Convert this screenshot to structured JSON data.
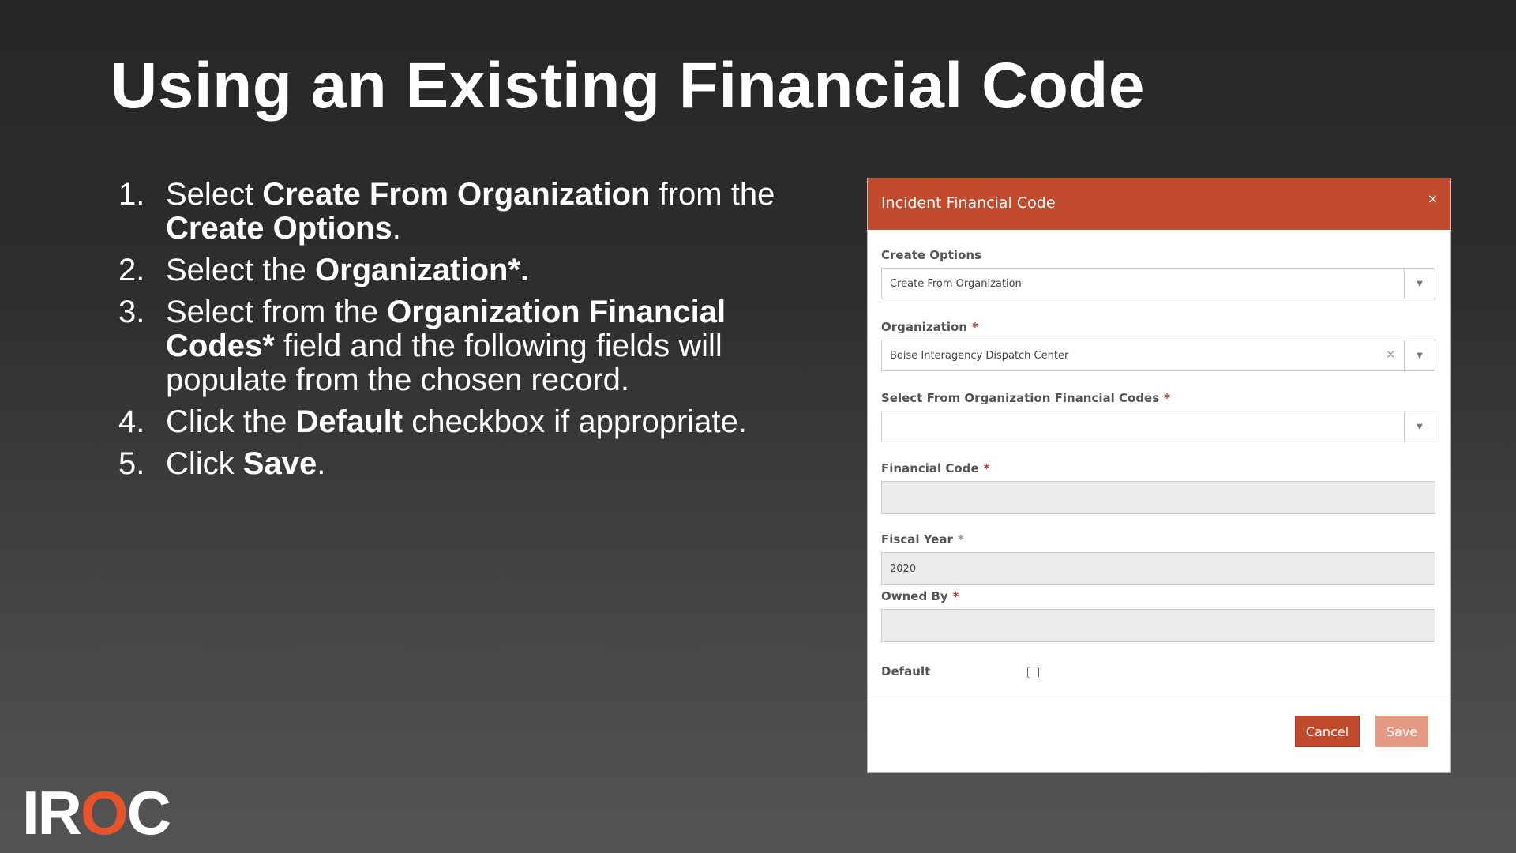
{
  "slide": {
    "title": "Using an Existing Financial Code",
    "steps": [
      {
        "num": "1.",
        "parts": [
          "Select ",
          "Create From Organization",
          " from the ",
          "Create Options",
          "."
        ]
      },
      {
        "num": "2.",
        "parts": [
          "Select the ",
          "Organization*."
        ]
      },
      {
        "num": "3.",
        "parts": [
          "Select from the ",
          "Organization Financial Codes*",
          " field and the following fields will populate from the chosen record."
        ]
      },
      {
        "num": "4.",
        "parts": [
          "Click the ",
          "Default",
          " checkbox if appropriate."
        ]
      },
      {
        "num": "5.",
        "parts": [
          "Click ",
          "Save",
          "."
        ]
      }
    ]
  },
  "dialog": {
    "title": "Incident Financial Code",
    "close_icon": "×",
    "fields": {
      "create_options": {
        "label": "Create Options",
        "value": "Create From Organization"
      },
      "organization": {
        "label": "Organization",
        "required": "*",
        "value": "Boise Interagency Dispatch Center",
        "clear": "×"
      },
      "org_financial_codes": {
        "label": "Select From Organization Financial Codes",
        "required": "*",
        "value": ""
      },
      "financial_code": {
        "label": "Financial Code",
        "required": "*",
        "value": ""
      },
      "fiscal_year": {
        "label": "Fiscal Year",
        "required": "*",
        "value": "2020"
      },
      "owned_by": {
        "label": "Owned By",
        "required": "*",
        "value": ""
      },
      "default": {
        "label": "Default",
        "checked": false
      }
    },
    "caret_icon": "▼",
    "buttons": {
      "cancel": "Cancel",
      "save": "Save"
    }
  },
  "logo": {
    "text": "IROC",
    "accent_color": "#e8532a"
  },
  "colors": {
    "header": "#c14a2c",
    "save_disabled": "#e49a85",
    "required": "#c0392b"
  }
}
